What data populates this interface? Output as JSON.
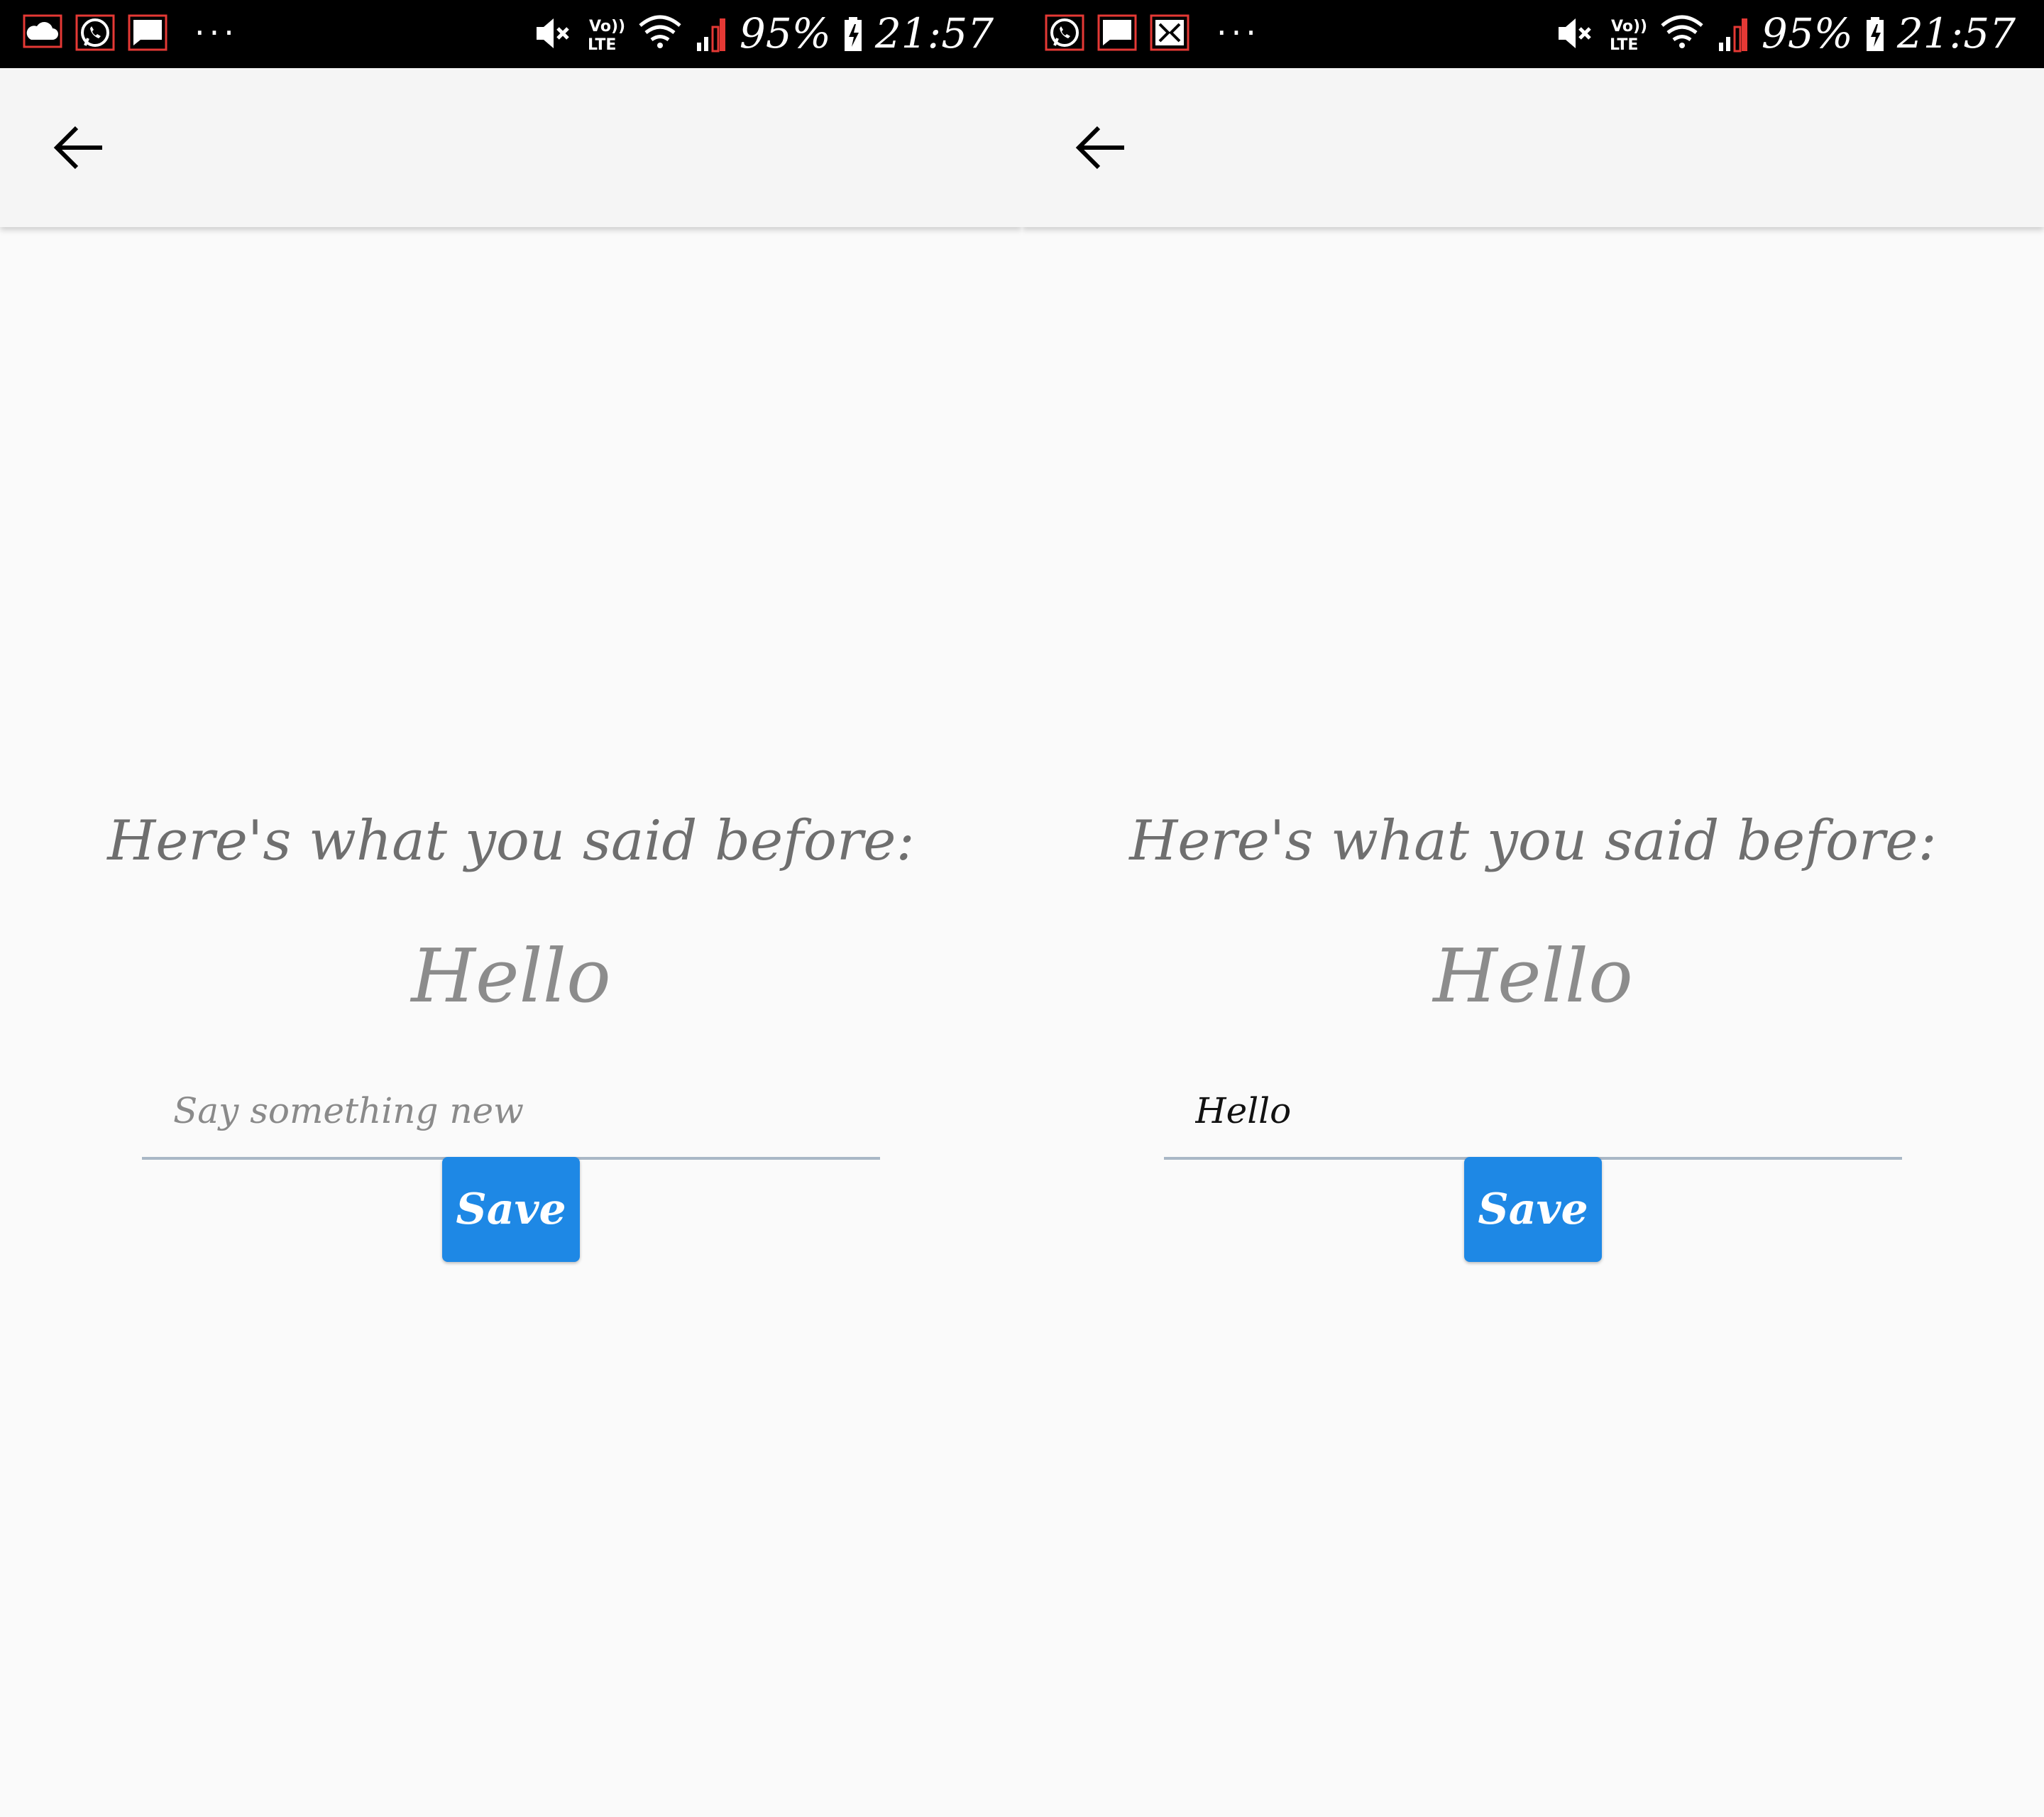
{
  "screens": [
    {
      "status_bar": {
        "notification_icons": [
          "cloud-icon",
          "whatsapp-icon",
          "message-icon"
        ],
        "overflow": "···",
        "system_icons": [
          "mute-icon",
          "volte-icon",
          "wifi-icon",
          "signal-icon"
        ],
        "battery_percent": "95%",
        "time": "21:57"
      },
      "app_bar": {
        "back_icon": "arrow-left-icon"
      },
      "heading": "Here's what you said before:",
      "previous_text": "Hello",
      "input": {
        "value": "",
        "placeholder": "Say something new"
      },
      "save_label": "Save"
    },
    {
      "status_bar": {
        "notification_icons": [
          "whatsapp-icon",
          "message-icon",
          "gallery-icon"
        ],
        "overflow": "···",
        "system_icons": [
          "mute-icon",
          "volte-icon",
          "wifi-icon",
          "signal-icon"
        ],
        "battery_percent": "95%",
        "time": "21:57"
      },
      "app_bar": {
        "back_icon": "arrow-left-icon"
      },
      "heading": "Here's what you said before:",
      "previous_text": "Hello",
      "input": {
        "value": "Hello",
        "placeholder": "Say something new"
      },
      "save_label": "Save"
    }
  ],
  "colors": {
    "status_bar_bg": "#000000",
    "app_bar_bg": "#f5f5f5",
    "page_bg": "#fafafa",
    "heading_text": "#6f6f6f",
    "previous_text": "#8c8c8c",
    "input_underline": "#a9b7c6",
    "save_button": "#1e88e5",
    "signal_warning": "#e53935"
  }
}
